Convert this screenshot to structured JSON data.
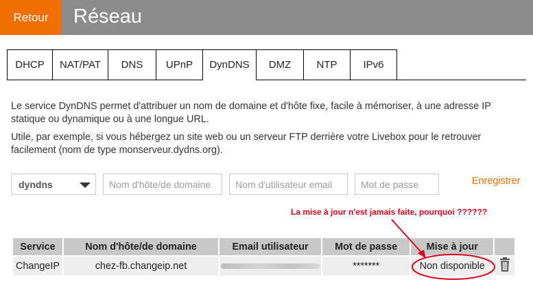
{
  "header": {
    "back_label": "Retour",
    "title": "Réseau"
  },
  "tabs": [
    {
      "label": "DHCP"
    },
    {
      "label": "NAT/PAT"
    },
    {
      "label": "DNS"
    },
    {
      "label": "UPnP"
    },
    {
      "label": "DynDNS"
    },
    {
      "label": "DMZ"
    },
    {
      "label": "NTP"
    },
    {
      "label": "IPv6"
    }
  ],
  "active_tab": "DynDNS",
  "description": {
    "p1": "Le service DynDNS permet d'attribuer un nom de domaine et d'hôte fixe, facile à mémoriser, à une adresse IP statique ou dynamique ou à une longue URL.",
    "p2": "Utile, par exemple, si vous hébergez un site web ou un serveur FTP derrière votre Livebox pour le retrouver facilement (nom de type monserveur.dydns.org)."
  },
  "form": {
    "service_selected": "dyndns",
    "host_placeholder": "Nom d'hôte/de domaine",
    "user_placeholder": "Nom d'utilisateur email",
    "password_placeholder": "Mot de passe",
    "save_label": "Enregistrer"
  },
  "annotation": {
    "text": "La mise à jour n'est jamais faite, pourquoi ??????",
    "color": "#e0001b"
  },
  "table": {
    "headers": [
      "Service",
      "Nom d'hôte/de domaine",
      "Email utilisateur",
      "Mot de passe",
      "Mise à jour"
    ],
    "row": {
      "service": "ChangeIP",
      "host": "chez-fb.changeip.net",
      "password": "*******",
      "update": "Non disponible"
    }
  },
  "colors": {
    "accent": "#f16e00",
    "header_bg": "#8c8c8c"
  },
  "icons": {
    "delete": "trash-icon",
    "select": "chevron-down-icon"
  }
}
